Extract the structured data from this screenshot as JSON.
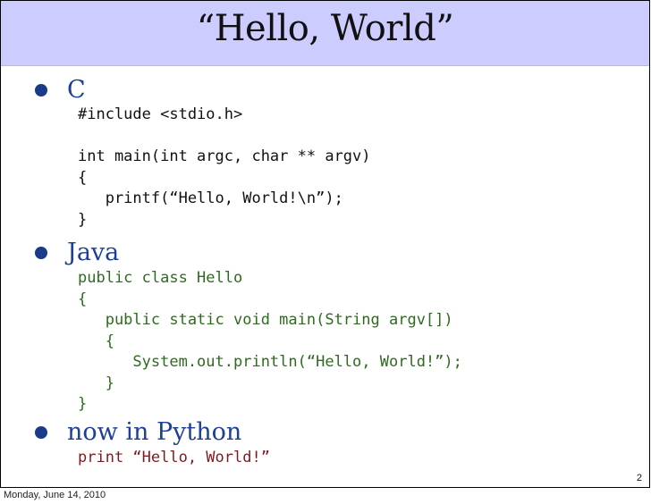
{
  "slide": {
    "title": "“Hello, World”",
    "page_number": "2"
  },
  "sections": [
    {
      "heading": "C",
      "code": "#include <stdio.h>\n\nint main(int argc, char ** argv)\n{\n   printf(“Hello, World!\\n”);\n}"
    },
    {
      "heading": "Java",
      "code": "public class Hello\n{\n   public static void main(String argv[])\n   {\n      System.out.println(“Hello, World!”);\n   }\n}"
    },
    {
      "heading": "now in Python",
      "code": "print “Hello, World!”"
    }
  ],
  "footer": {
    "date": "Monday, June 14, 2010"
  },
  "colors": {
    "title_bar": "#ccccff",
    "heading": "#1d3f96",
    "c_code": "#111111",
    "java_code": "#2e6b1f",
    "python_code": "#7a1c22"
  }
}
